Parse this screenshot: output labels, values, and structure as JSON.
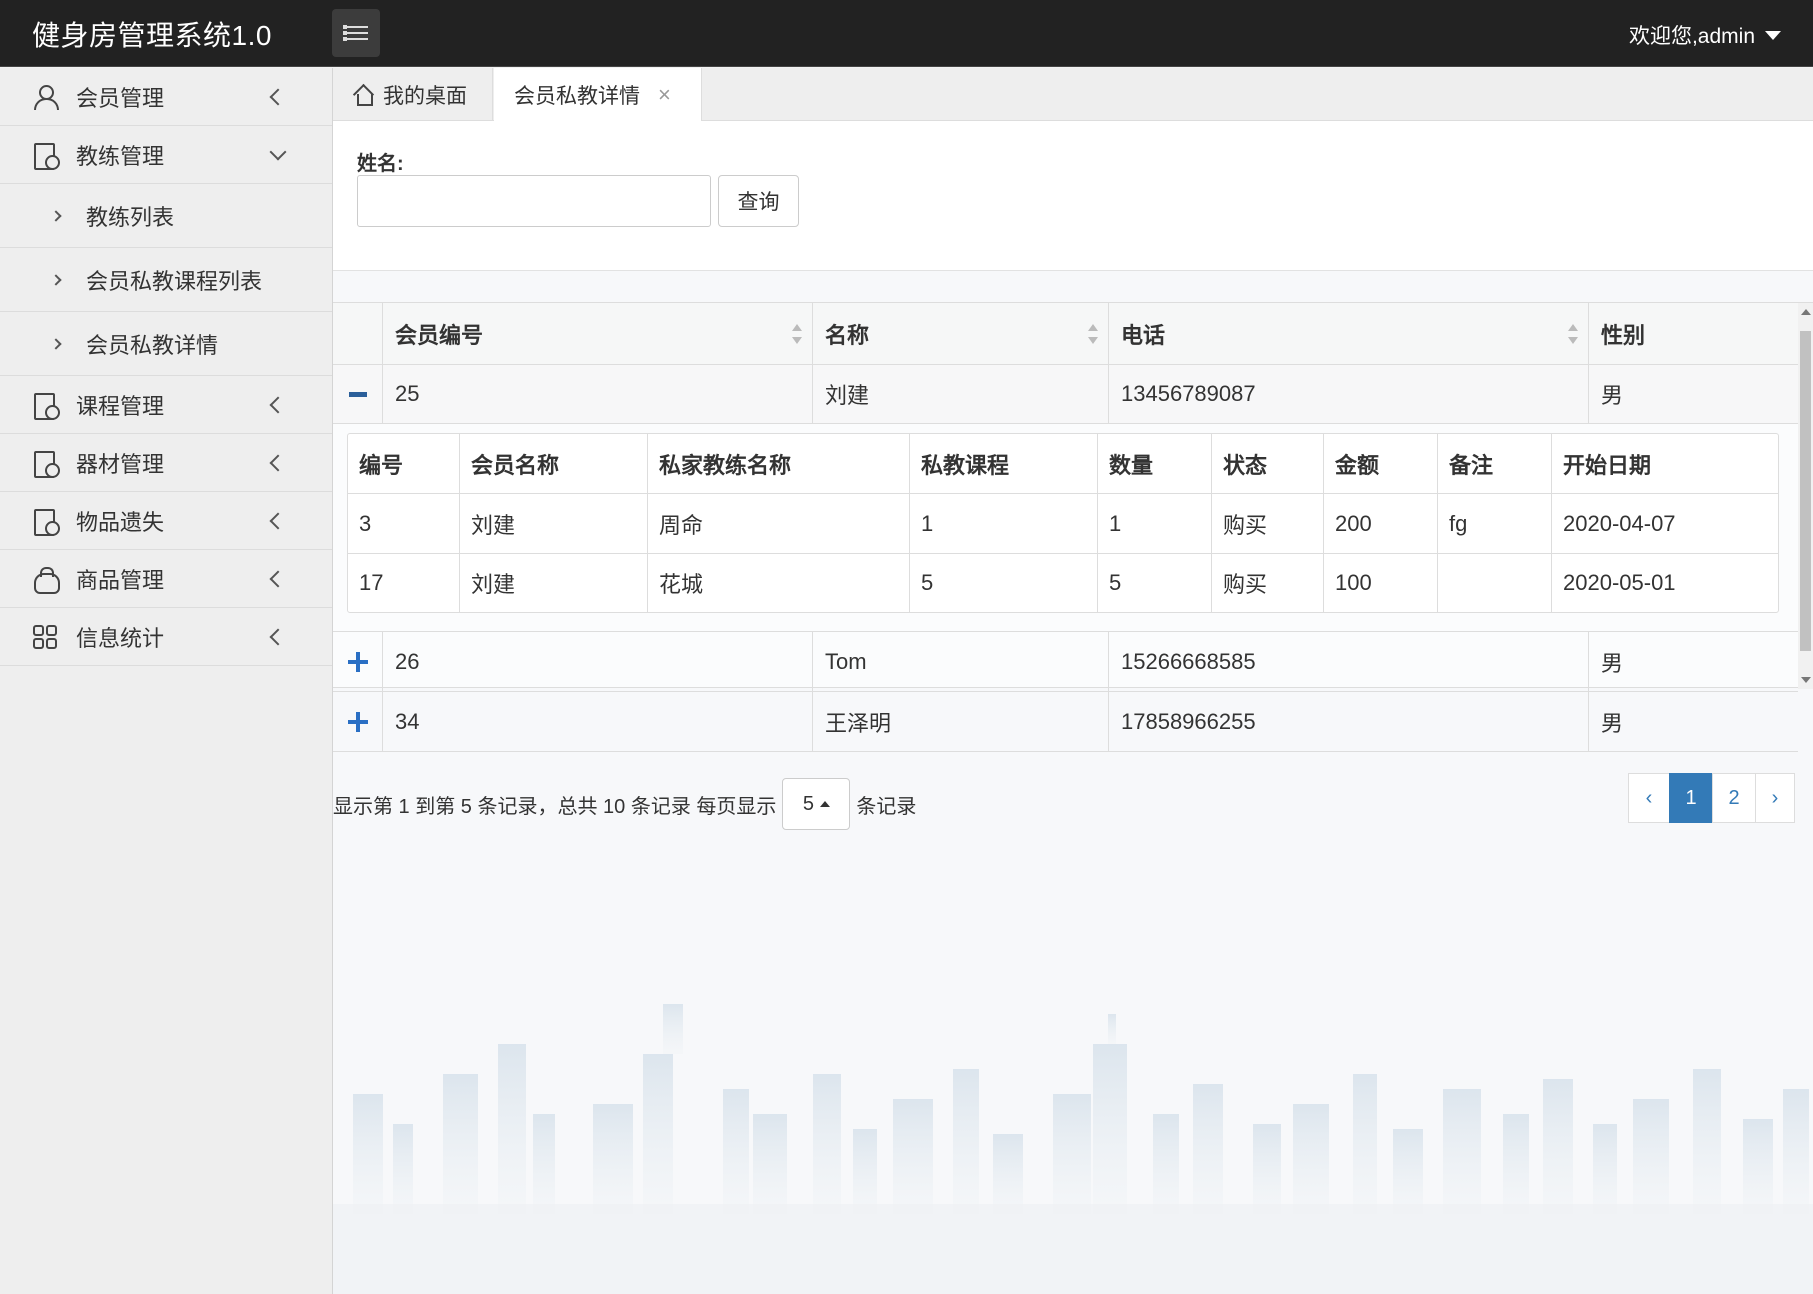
{
  "app": {
    "title": "健身房管理系统1.0",
    "user_greeting": "欢迎您,admin"
  },
  "sidebar": {
    "items": [
      {
        "label": "会员管理",
        "icon": "user-icon"
      },
      {
        "label": "教练管理",
        "icon": "document-icon",
        "expanded": true,
        "children": [
          {
            "label": "教练列表"
          },
          {
            "label": "会员私教课程列表"
          },
          {
            "label": "会员私教详情"
          }
        ]
      },
      {
        "label": "课程管理",
        "icon": "document-icon"
      },
      {
        "label": "器材管理",
        "icon": "document-icon"
      },
      {
        "label": "物品遗失",
        "icon": "document-icon"
      },
      {
        "label": "商品管理",
        "icon": "bag-icon"
      },
      {
        "label": "信息统计",
        "icon": "grid-icon"
      }
    ]
  },
  "tabs": {
    "home": "我的桌面",
    "active": "会员私教详情",
    "close": "×"
  },
  "search": {
    "label": "姓名:",
    "value": "",
    "button": "查询"
  },
  "table": {
    "headers": [
      "会员编号",
      "名称",
      "电话",
      "性别"
    ],
    "rows": [
      {
        "id": "25",
        "name": "刘建",
        "phone": "13456789087",
        "gender": "男",
        "expanded": true
      },
      {
        "id": "26",
        "name": "Tom",
        "phone": "15266668585",
        "gender": "男",
        "expanded": false
      },
      {
        "id": "34",
        "name": "王泽明",
        "phone": "17858966255",
        "gender": "男",
        "expanded": false
      }
    ],
    "detail": {
      "headers": [
        "编号",
        "会员名称",
        "私家教练名称",
        "私教课程",
        "数量",
        "状态",
        "金额",
        "备注",
        "开始日期"
      ],
      "rows": [
        [
          "3",
          "刘建",
          "周命",
          "1",
          "1",
          "购买",
          "200",
          "fg",
          "2020-04-07"
        ],
        [
          "17",
          "刘建",
          "花城",
          "5",
          "5",
          "购买",
          "100",
          "",
          "2020-05-01"
        ]
      ]
    }
  },
  "pagination": {
    "info_prefix": "显示第 1 到第 5 条记录，总共 10 条记录 每页显示",
    "page_size": "5",
    "info_suffix": "条记录",
    "prev": "‹",
    "pages": [
      "1",
      "2"
    ],
    "next": "›",
    "current": "1"
  },
  "colors": {
    "topbar": "#222222",
    "accent": "#337ab7",
    "toggle": "#2a6fc4"
  }
}
